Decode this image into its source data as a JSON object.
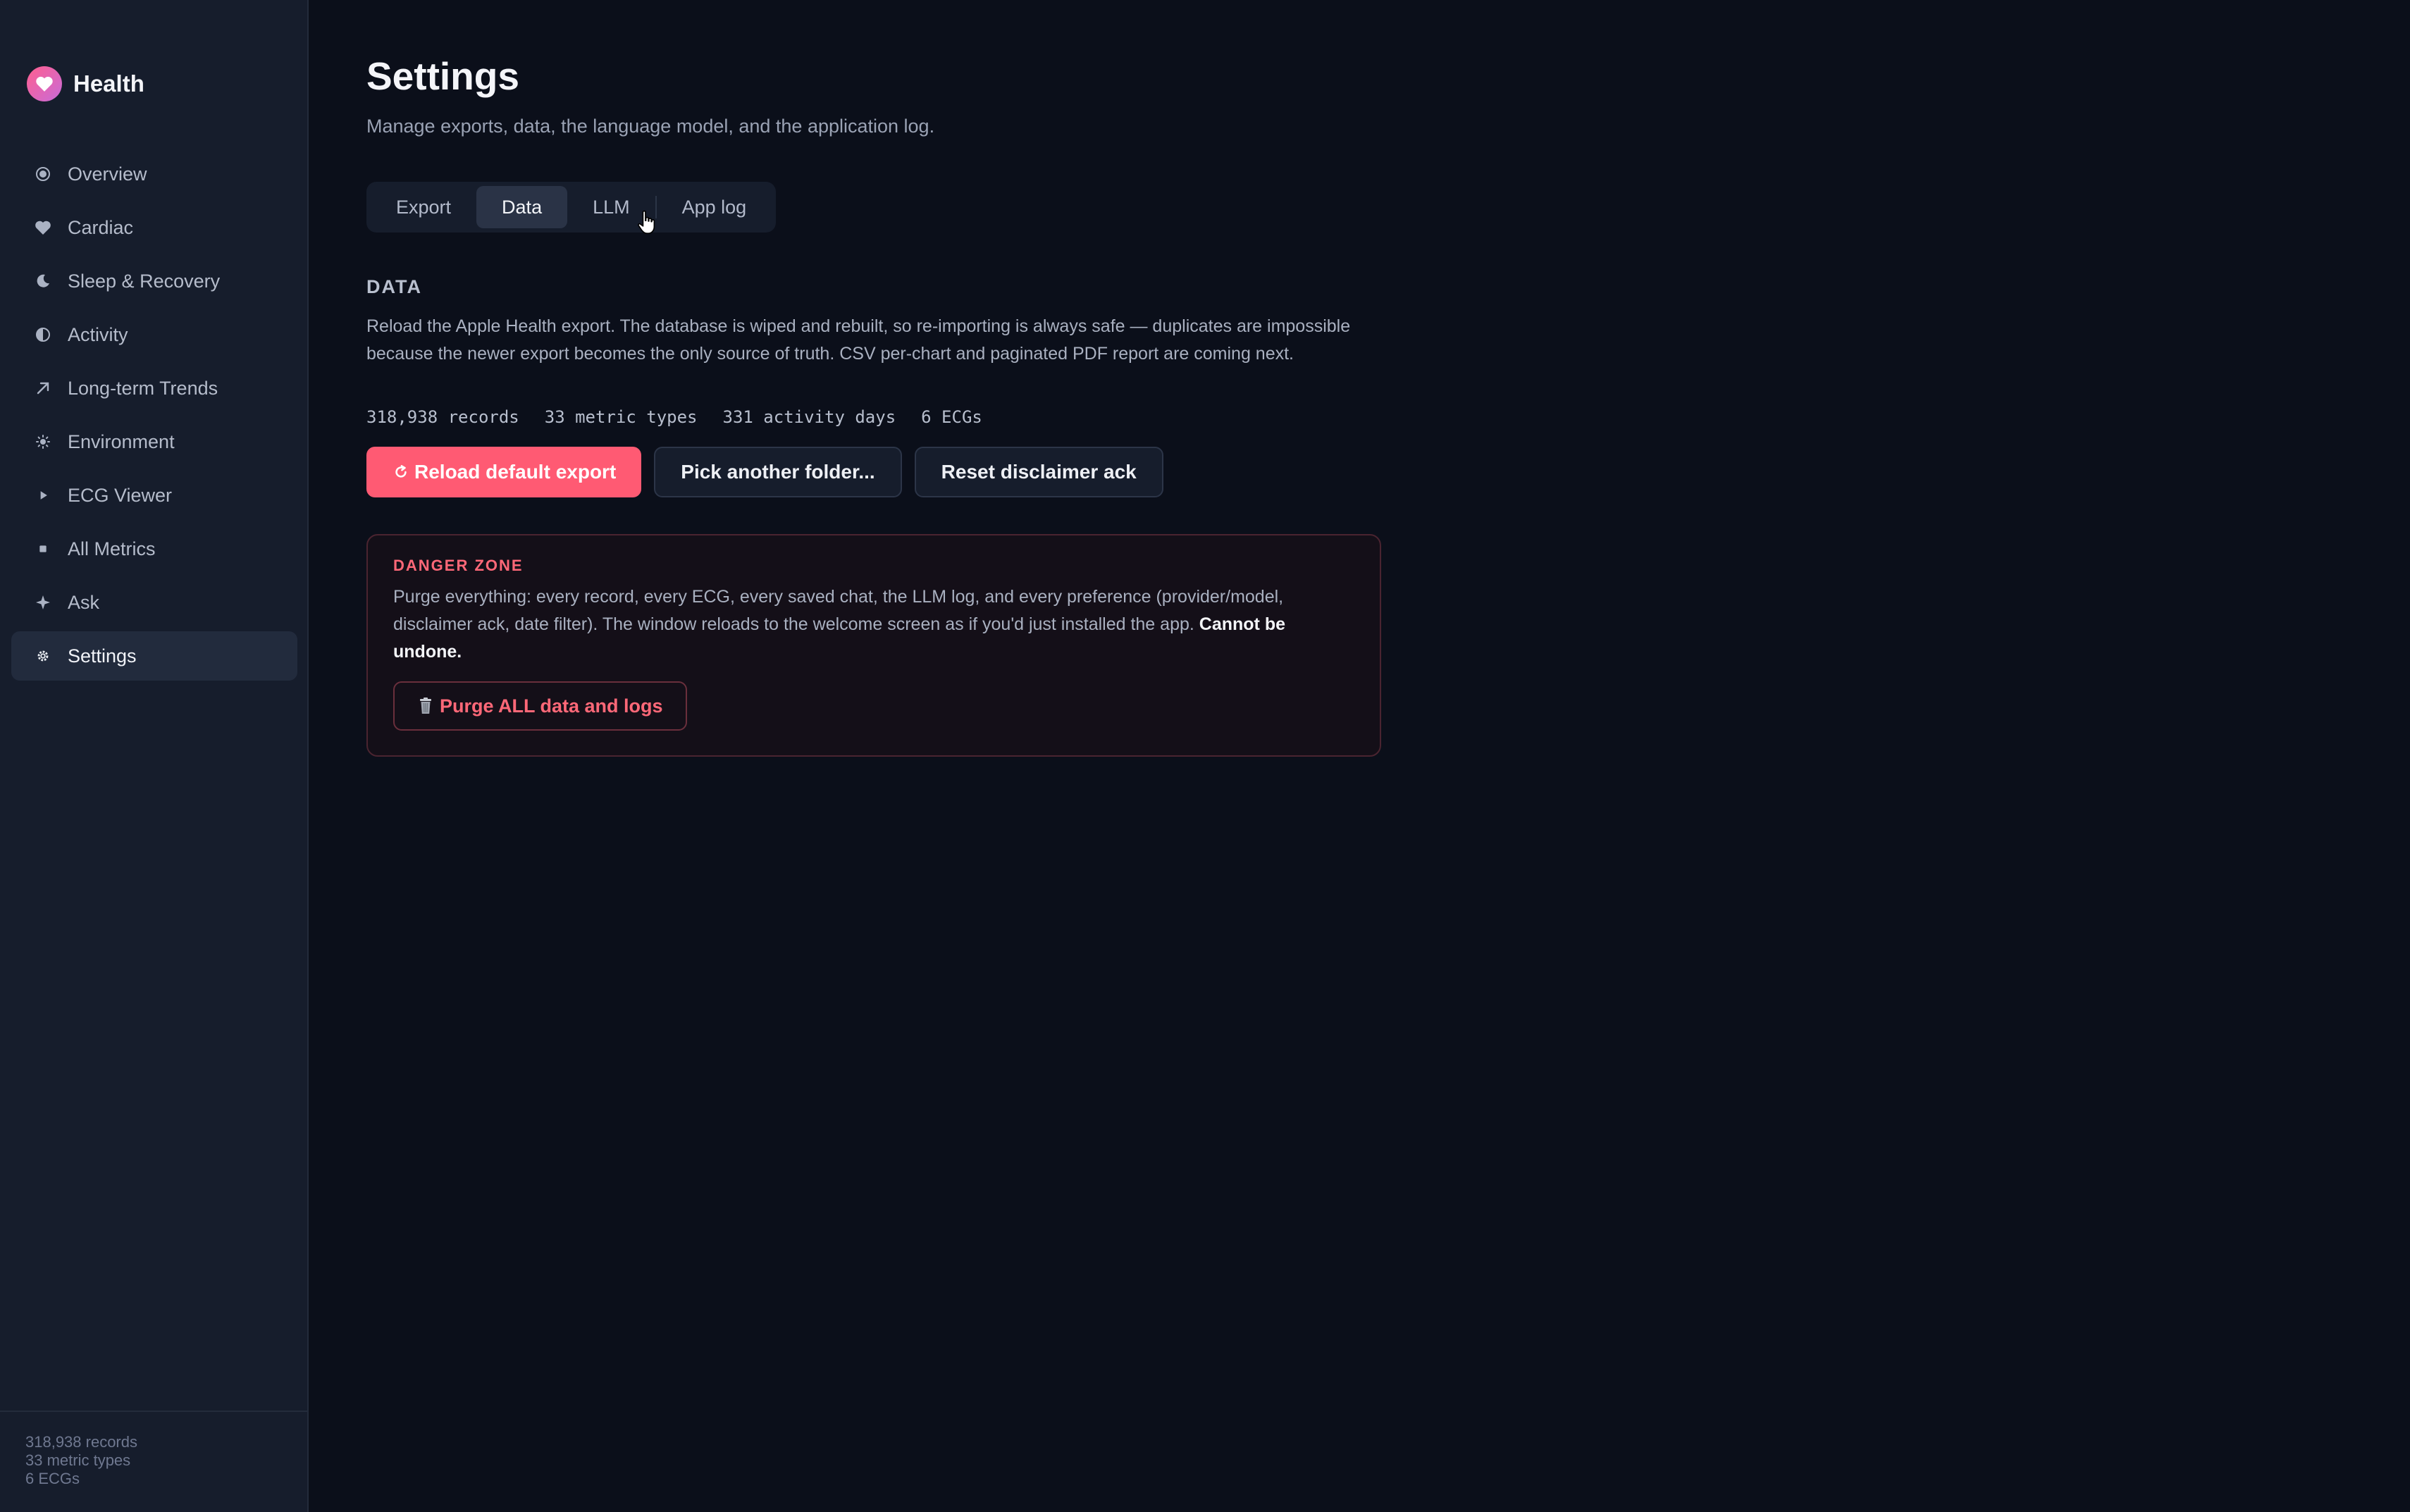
{
  "app": {
    "name": "Health"
  },
  "sidebar": {
    "items": [
      {
        "label": "Overview",
        "icon": "overview-icon"
      },
      {
        "label": "Cardiac",
        "icon": "heart-icon"
      },
      {
        "label": "Sleep & Recovery",
        "icon": "moon-icon"
      },
      {
        "label": "Activity",
        "icon": "half-circle-icon"
      },
      {
        "label": "Long-term Trends",
        "icon": "trend-arrow-icon"
      },
      {
        "label": "Environment",
        "icon": "sun-icon"
      },
      {
        "label": "ECG Viewer",
        "icon": "play-icon"
      },
      {
        "label": "All Metrics",
        "icon": "square-icon"
      },
      {
        "label": "Ask",
        "icon": "sparkle-icon"
      },
      {
        "label": "Settings",
        "icon": "gear-icon",
        "active": true
      }
    ],
    "footer": {
      "records": "318,938 records",
      "metric_types": "33 metric types",
      "ecgs": "6 ECGs"
    }
  },
  "page": {
    "title": "Settings",
    "subtitle": "Manage exports, data, the language model, and the application log."
  },
  "tabs": [
    {
      "label": "Export"
    },
    {
      "label": "Data",
      "active": true
    },
    {
      "label": "LLM"
    },
    {
      "label": "App log"
    }
  ],
  "data_section": {
    "title": "DATA",
    "description": "Reload the Apple Health export. The database is wiped and rebuilt, so re-importing is always safe — duplicates are impossible because the newer export becomes the only source of truth. CSV per-chart and paginated PDF report are coming next.",
    "stats": [
      "318,938 records",
      "33 metric types",
      "331 activity days",
      "6 ECGs"
    ],
    "buttons": {
      "reload": "Reload default export",
      "pick_folder": "Pick another folder...",
      "reset_ack": "Reset disclaimer ack"
    }
  },
  "danger_zone": {
    "title": "DANGER ZONE",
    "text": "Purge everything: every record, every ECG, every saved chat, the LLM log, and every preference (provider/model, disclaimer ack, date filter). The window reloads to the welcome screen as if you'd just installed the app.",
    "emphasis": "Cannot be undone.",
    "button": "Purge ALL data and logs"
  },
  "colors": {
    "accent": "#ff5a73",
    "danger": "#ff6878",
    "background": "#0b0f1a",
    "sidebar": "#161d2c"
  }
}
